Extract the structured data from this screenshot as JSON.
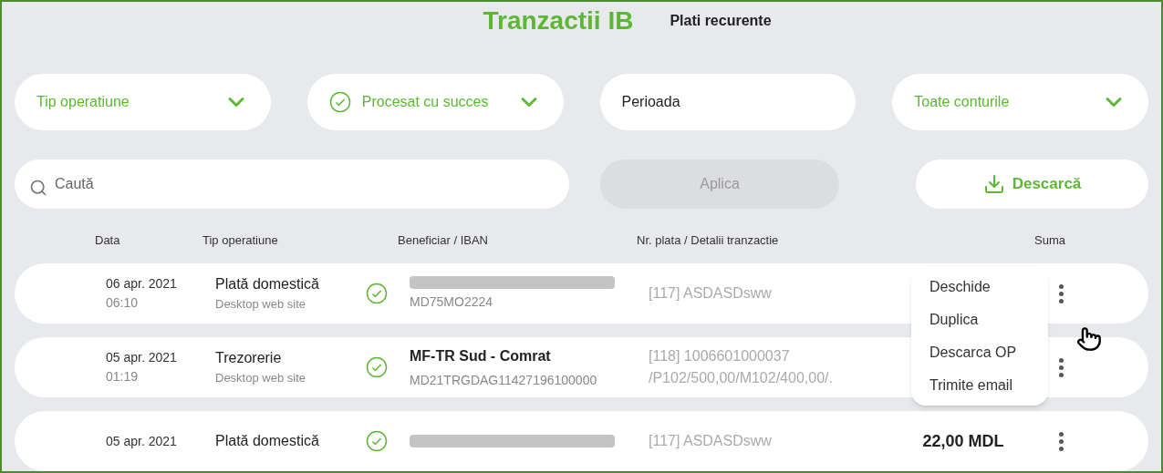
{
  "header": {
    "title": "Tranzactii IB",
    "tabs": [
      {
        "label": "Plati recurente",
        "selected": false
      }
    ]
  },
  "filters": [
    {
      "kind": "dropdown",
      "label": "Tip operatiune",
      "checked": false
    },
    {
      "kind": "dropdown",
      "label": "Procesat cu succes",
      "checked": true
    },
    {
      "kind": "date",
      "label": "Perioada",
      "checked": false
    },
    {
      "kind": "dropdown",
      "label": "Toate conturile",
      "checked": false
    }
  ],
  "search": {
    "placeholder": "Caută"
  },
  "apply_button": {
    "label": "Aplica",
    "disabled": true
  },
  "download_button": {
    "label": "Descarcă"
  },
  "table": {
    "columns": [
      "Data",
      "Tip operatiune",
      "Beneficiar / IBAN",
      "Nr. plata / Detalii tranzactie",
      "Suma"
    ],
    "rows": [
      {
        "date": "06 apr. 2021",
        "time": "06:10",
        "type": "Plată domestică",
        "channel": "Desktop web site",
        "processed": true,
        "iban": "MD75MO2224",
        "redacted": true,
        "ref": "[117]",
        "details": "ASDASDsww"
      },
      {
        "date": "05 apr. 2021",
        "time": "01:19",
        "type": "Trezorerie",
        "channel": "Desktop web site",
        "processed": true,
        "beneficiary": "MF-TR Sud - Comrat",
        "iban": "MD21TRGDAG11427196100000",
        "redacted": false,
        "ref": "[118]",
        "details": "1006601000037 /P102/500,00/M102/400,00/."
      },
      {
        "date": "05 apr. 2021",
        "type": "Plată domestică",
        "processed": true,
        "redacted": true,
        "ref": "[117]",
        "details": "ASDASDsww",
        "amount": "22,00 MDL"
      }
    ]
  },
  "context_menu": {
    "items": [
      "Deschide",
      "Duplica",
      "Descarca OP",
      "Trimite email"
    ]
  }
}
